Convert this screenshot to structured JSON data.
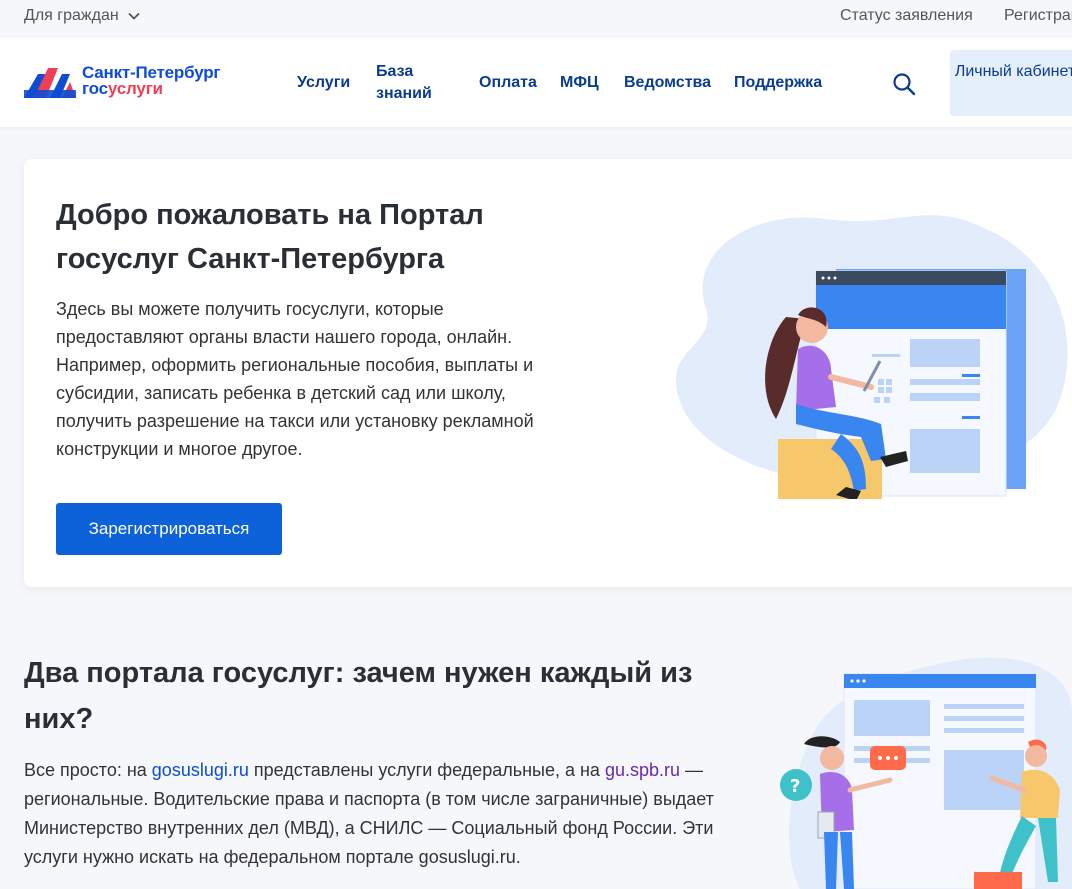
{
  "topbar": {
    "citizens_label": "Для граждан",
    "status_label": "Статус заявления",
    "register_label": "Регистрация"
  },
  "logo": {
    "line1": "Санкт-Петербург",
    "line2_part1": "гос",
    "line2_part2": "услуги"
  },
  "nav": {
    "items": [
      {
        "label": "Услуги"
      },
      {
        "label": "База знаний"
      },
      {
        "label": "Оплата"
      },
      {
        "label": "МФЦ"
      },
      {
        "label": "Ведомства"
      },
      {
        "label": "Поддержка"
      }
    ],
    "cabinet_label": "Личный кабинет"
  },
  "welcome": {
    "title": "Добро пожаловать на Портал госуслуг Санкт-Петербурга",
    "description": "Здесь вы можете получить госуслуги, которые предоставляют органы власти нашего города, онлайн. Например, оформить региональные пособия, выплаты и субсидии, записать ребенка в детский сад или школу, получить разрешение на такси или установку рекламной конструкции и многое другое.",
    "register_button": "Зарегистрироваться"
  },
  "two_portals": {
    "title": "Два портала госуслуг: зачем нужен каждый из них?",
    "text_part1": "Все просто: на ",
    "link1": "gosuslugi.ru",
    "text_part2": " представлены услуги федеральные, а на ",
    "link2": "gu.spb.ru",
    "text_part3": " — региональные. Водительские права и паспорта (в том числе заграничные) выдает Министерство внутренних дел (МВД), а СНИЛС — Социальный фонд России. Эти услуги нужно искать на федеральном портале gosuslugi.ru."
  },
  "colors": {
    "primary": "#0d62d9",
    "nav_text": "#0b3c8f",
    "logo_blue": "#0d4cd3",
    "logo_red": "#ee3f58",
    "cabinet_bg": "#e5eefb"
  },
  "icons": {
    "chevron": "chevron-down-icon",
    "search": "search-icon",
    "logo": "gosuslugi-logo-icon"
  }
}
